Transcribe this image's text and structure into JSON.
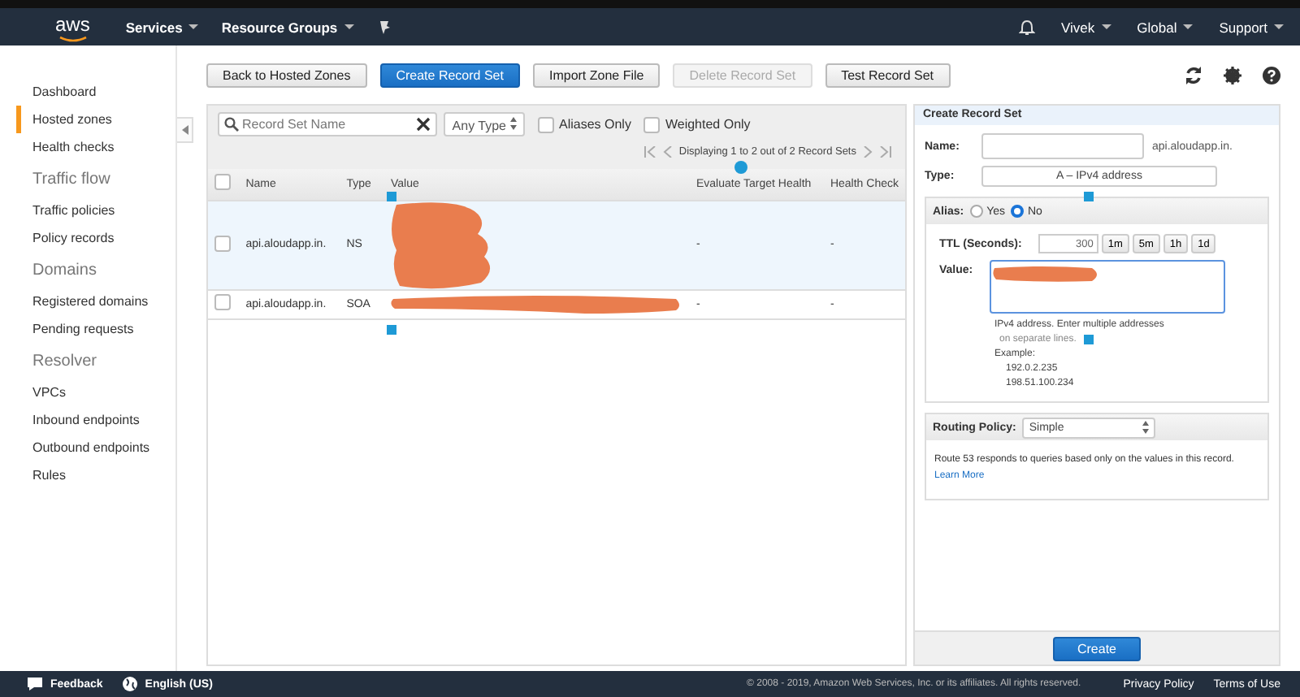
{
  "nav": {
    "logo": "aws",
    "menus": [
      {
        "label": "Services"
      },
      {
        "label": "Resource Groups"
      }
    ],
    "user_menus": [
      {
        "label": "Vivek"
      },
      {
        "label": "Global"
      },
      {
        "label": "Support"
      }
    ]
  },
  "sidebar": {
    "sections": [
      {
        "items": [
          {
            "label": "Dashboard",
            "selected": false
          },
          {
            "label": "Hosted zones",
            "selected": true
          },
          {
            "label": "Health checks",
            "selected": false
          }
        ]
      },
      {
        "heading": "Traffic flow",
        "items": [
          {
            "label": "Traffic policies",
            "selected": false
          },
          {
            "label": "Policy records",
            "selected": false
          }
        ]
      },
      {
        "heading": "Domains",
        "items": [
          {
            "label": "Registered domains",
            "selected": false
          },
          {
            "label": "Pending requests",
            "selected": false
          }
        ]
      },
      {
        "heading": "Resolver",
        "items": [
          {
            "label": "VPCs",
            "selected": false
          },
          {
            "label": "Inbound endpoints",
            "selected": false
          },
          {
            "label": "Outbound endpoints",
            "selected": false
          },
          {
            "label": "Rules",
            "selected": false
          }
        ]
      }
    ]
  },
  "toolbar": {
    "buttons": [
      {
        "label": "Back to Hosted Zones",
        "kind": "default",
        "disabled": false
      },
      {
        "label": "Create Record Set",
        "kind": "primary",
        "disabled": false
      },
      {
        "label": "Import Zone File",
        "kind": "default",
        "disabled": false
      },
      {
        "label": "Delete Record Set",
        "kind": "default",
        "disabled": true
      },
      {
        "label": "Test Record Set",
        "kind": "default",
        "disabled": false
      }
    ]
  },
  "filter": {
    "search": {
      "placeholder": "Record Set Name"
    },
    "type_select": "Any Type",
    "checkboxes": [
      {
        "label": "Aliases Only",
        "checked": false
      },
      {
        "label": "Weighted Only",
        "checked": false
      }
    ]
  },
  "pagination": "Displaying 1 to 2 out of 2 Record Sets",
  "table": {
    "select_all_checked": false,
    "columns": [
      "Name",
      "Type",
      "Value",
      "Evaluate Target Health",
      "Health Check"
    ],
    "rows": [
      {
        "selected": true,
        "checked": false,
        "name": "api.aloudapp.in.",
        "type": "NS",
        "value_redacted": true,
        "evaluate": "-",
        "health": "-"
      },
      {
        "selected": false,
        "checked": false,
        "name": "api.aloudapp.in.",
        "type": "SOA",
        "value_redacted": true,
        "evaluate": "-",
        "health": "-"
      }
    ]
  },
  "form": {
    "title": "Create Record Set",
    "name_label": "Name:",
    "name_suffix": "api.aloudapp.in.",
    "type_label": "Type:",
    "type_value": "A – IPv4 address",
    "alias_label": "Alias:",
    "alias_options": [
      {
        "label": "Yes",
        "selected": false
      },
      {
        "label": "No",
        "selected": true
      }
    ],
    "ttl_label": "TTL (Seconds):",
    "ttl_value": "300",
    "ttl_buttons": [
      "1m",
      "5m",
      "1h",
      "1d"
    ],
    "value_label": "Value:",
    "value_redacted": true,
    "help": [
      "IPv4 address. Enter multiple addresses",
      "on separate lines.",
      "Example:",
      "192.0.2.235",
      "198.51.100.234"
    ],
    "routing_label": "Routing Policy:",
    "routing_value": "Simple",
    "routing_note": "Route 53 responds to queries based only on the values in this record.",
    "learn_more": "Learn More",
    "submit": "Create"
  },
  "footer": {
    "feedback": "Feedback",
    "language": "English (US)",
    "copyright": "© 2008 - 2019, Amazon Web Services, Inc. or its affiliates. All rights reserved.",
    "links": [
      "Privacy Policy",
      "Terms of Use"
    ]
  }
}
